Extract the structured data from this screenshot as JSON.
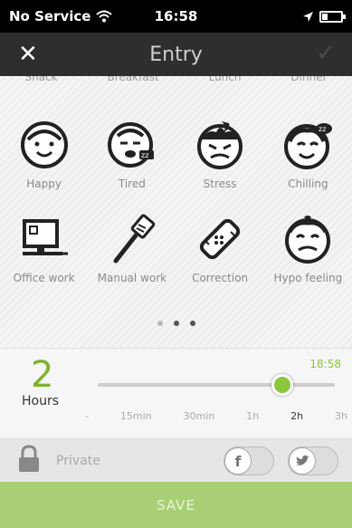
{
  "status": {
    "carrier": "No Service",
    "time": "16:58"
  },
  "header": {
    "title": "Entry"
  },
  "categories": [
    "Snack",
    "Breakfast",
    "Lunch",
    "Dinner"
  ],
  "moods": [
    {
      "label": "Happy",
      "icon": "happy-face-icon"
    },
    {
      "label": "Tired",
      "icon": "tired-face-icon"
    },
    {
      "label": "Stress",
      "icon": "stress-face-icon"
    },
    {
      "label": "Chilling",
      "icon": "chilling-face-icon"
    }
  ],
  "activities": [
    {
      "label": "Office work",
      "icon": "computer-icon"
    },
    {
      "label": "Manual work",
      "icon": "spatula-icon"
    },
    {
      "label": "Correction",
      "icon": "bandage-icon"
    },
    {
      "label": "Hypo feeling",
      "icon": "hypo-face-icon"
    }
  ],
  "pager": {
    "pages": 3,
    "current": 2
  },
  "duration": {
    "value": "2",
    "unit": "Hours",
    "time": "18:58",
    "ticks": [
      "-",
      "15min",
      "30min",
      "1h",
      "2h",
      "3h"
    ],
    "selected_index": 4,
    "slider_fraction": 0.78
  },
  "private": {
    "label": "Private"
  },
  "social": {
    "facebook": "f",
    "twitter": "t"
  },
  "save": {
    "label": "SAVE"
  },
  "colors": {
    "accent": "#8cc63f",
    "save_bg": "#a9cf76",
    "nav_bg": "#2e2e2e"
  }
}
